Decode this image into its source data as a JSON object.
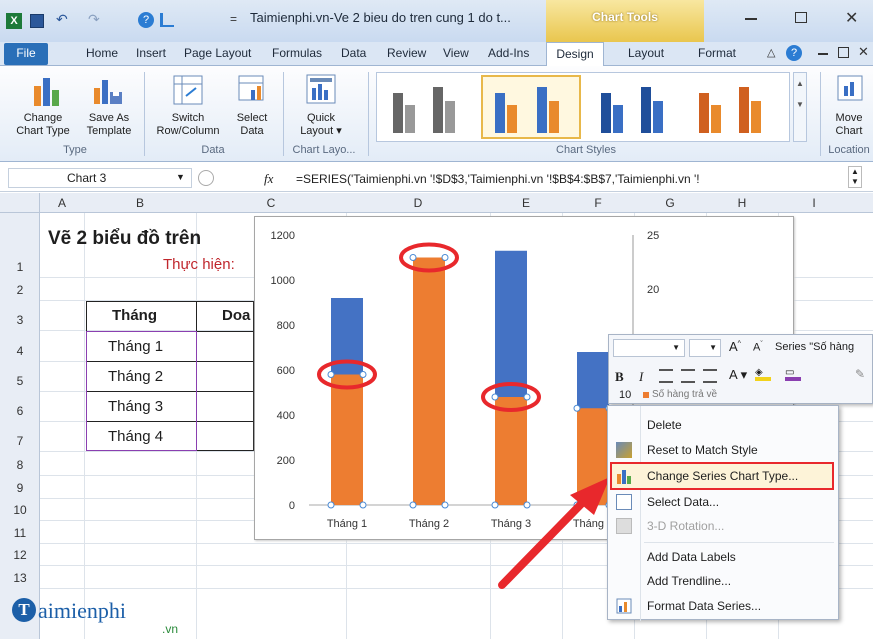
{
  "window": {
    "title": "Taimienphi.vn-Ve 2 bieu do tren cung 1 do t...",
    "chart_tools": "Chart Tools"
  },
  "tabs": [
    "File",
    "Home",
    "Insert",
    "Page Layout",
    "Formulas",
    "Data",
    "Review",
    "View",
    "Add-Ins",
    "Design",
    "Layout",
    "Format"
  ],
  "ribbon": {
    "change_chart_type": "Change\nChart Type",
    "save_template": "Save As\nTemplate",
    "switch_rowcol": "Switch\nRow/Column",
    "select_data": "Select\nData",
    "quick_layout": "Quick\nLayout ▾",
    "move_chart": "Move\nChart",
    "group_type": "Type",
    "group_data": "Data",
    "group_layouts": "Chart Layo...",
    "group_styles": "Chart Styles",
    "group_location": "Location"
  },
  "formula_bar": {
    "name_box": "Chart 3",
    "fx": "fx",
    "formula": "=SERIES('Taimienphi.vn '!$D$3,'Taimienphi.vn '!$B$4:$B$7,'Taimienphi.vn '!"
  },
  "columns": [
    "A",
    "B",
    "C",
    "D",
    "E",
    "F",
    "G",
    "H",
    "I"
  ],
  "rows": [
    "1",
    "2",
    "3",
    "4",
    "5",
    "6",
    "7",
    "8",
    "9",
    "10",
    "11",
    "12",
    "13"
  ],
  "sheet": {
    "title": "Vẽ 2 biểu đồ trên",
    "subtitle": "Thực hiện:",
    "header_month": "Tháng",
    "header_partial": "Doa",
    "months": [
      "Tháng 1",
      "Tháng 2",
      "Tháng 3",
      "Tháng 4"
    ]
  },
  "chart_data": {
    "type": "bar",
    "categories": [
      "Tháng 1",
      "Tháng 2",
      "Tháng 3",
      "Tháng 4"
    ],
    "y_ticks_left": [
      "0",
      "200",
      "400",
      "600",
      "800",
      "1000",
      "1200"
    ],
    "y_ticks_right": [
      "20",
      "25"
    ],
    "ylim": [
      0,
      1200
    ],
    "series": [
      {
        "values": [
          920,
          1100,
          1130,
          680
        ],
        "color": "#4472c4"
      },
      {
        "values": [
          580,
          1100,
          480,
          430
        ],
        "color": "#ed7d31"
      }
    ]
  },
  "mini_toolbar": {
    "series_label": "Series \"Số hàng",
    "legend_value": "10",
    "legend_text": "Số hàng trả về"
  },
  "context_menu": {
    "items": [
      "Delete",
      "Reset to Match Style",
      "Change Series Chart Type...",
      "Select Data...",
      "3-D Rotation...",
      "Add Data Labels",
      "Add Trendline...",
      "Format Data Series..."
    ]
  },
  "watermark": {
    "brand": "aimienphi",
    "suffix": ".vn"
  }
}
